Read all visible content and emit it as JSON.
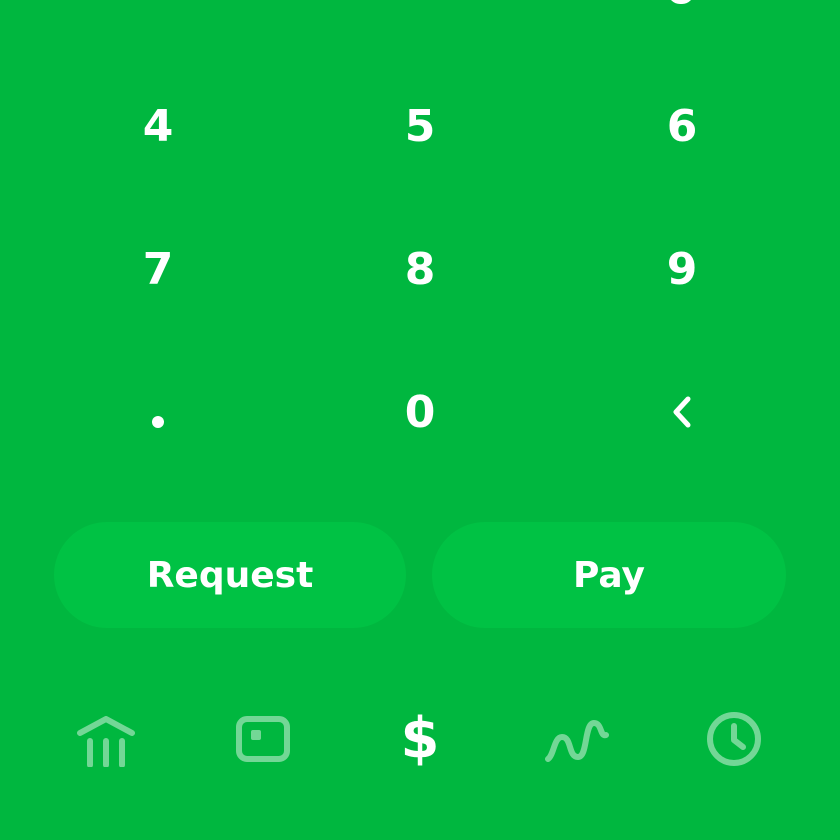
{
  "keypad": {
    "rows": [
      {
        "keys": [
          "4",
          "5",
          "6"
        ]
      },
      {
        "keys": [
          "7",
          "8",
          "9"
        ]
      },
      {
        "keys": [
          ".",
          "0",
          "<"
        ]
      }
    ]
  },
  "actions": {
    "request_label": "Request",
    "pay_label": "Pay"
  },
  "tabs": [
    {
      "name": "banking",
      "icon": "bank-icon"
    },
    {
      "name": "card",
      "icon": "card-icon"
    },
    {
      "name": "money",
      "icon": "dollar-icon",
      "symbol": "$"
    },
    {
      "name": "investing",
      "icon": "investing-icon"
    },
    {
      "name": "activity",
      "icon": "clock-icon"
    }
  ],
  "colors": {
    "background": "#00B73F",
    "button": "#00C244",
    "text": "#FFFFFF"
  }
}
